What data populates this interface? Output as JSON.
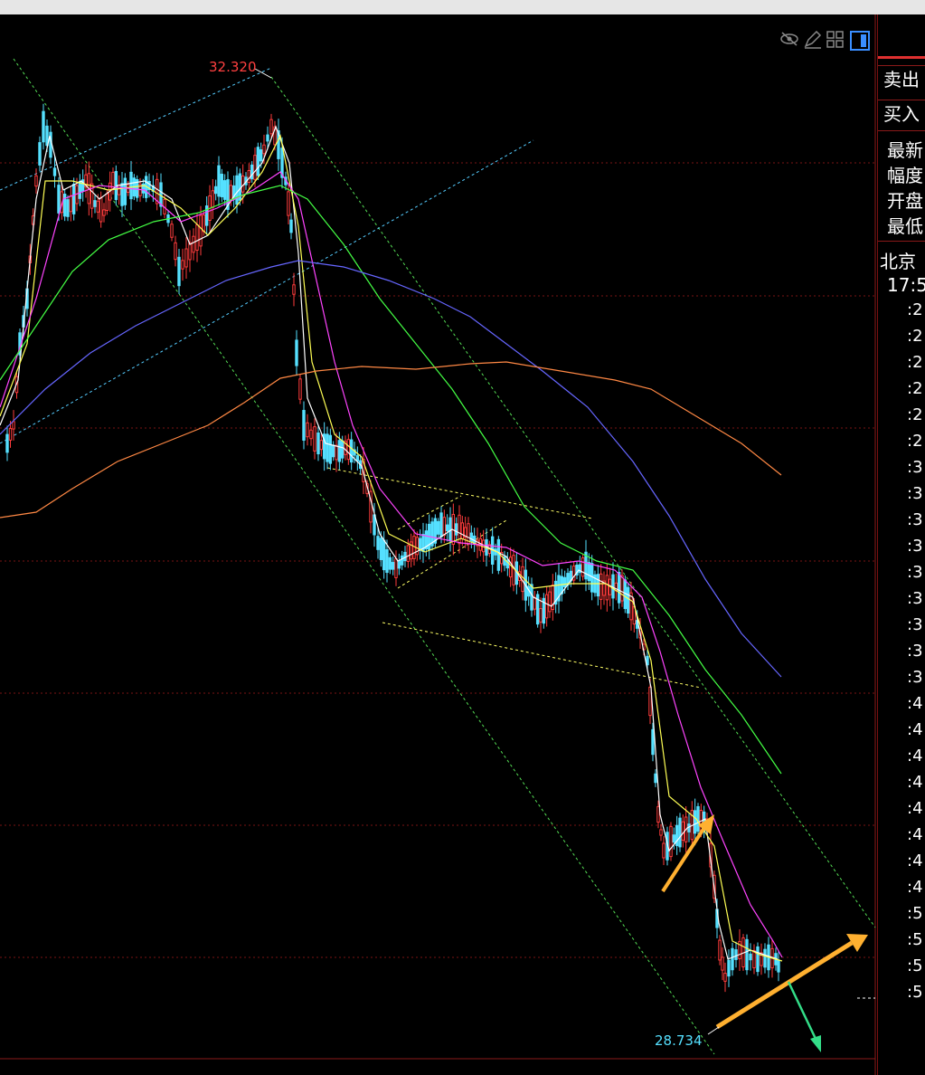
{
  "chart_data": {
    "type": "candlestick",
    "annotations": {
      "high": "32.320",
      "low": "28.734"
    },
    "price_range": [
      28.734,
      32.32
    ]
  },
  "panel": {
    "sell_label": "卖出",
    "buy_label": "买入",
    "quote_items": [
      "最新",
      "幅度",
      "开盘",
      "最低"
    ],
    "region": "北京",
    "time": "17:5",
    "ticks": [
      ":2",
      ":2",
      ":2",
      ":2",
      ":2",
      ":2",
      ":3",
      ":3",
      ":3",
      ":3",
      ":3",
      ":3",
      ":3",
      ":3",
      ":3",
      ":4",
      ":4",
      ":4",
      ":4",
      ":4",
      ":4",
      ":4",
      ":4",
      ":5",
      ":5",
      ":5",
      ":5"
    ]
  },
  "colors": {
    "background": "#000000",
    "up": "#ff3c3c",
    "down": "#55e0ff",
    "ma5": "#ffffff",
    "ma10": "#ffff55",
    "ma20": "#ff44ff",
    "ma30": "#44ff44",
    "ma60": "#6666ff",
    "ma120": "#ff8844",
    "arrow_up": "#ffb030",
    "arrow_down": "#33dd88"
  },
  "toolbar": {
    "icons": [
      "eye-off-icon",
      "pencil-icon",
      "grid-icon",
      "panel-icon"
    ]
  }
}
